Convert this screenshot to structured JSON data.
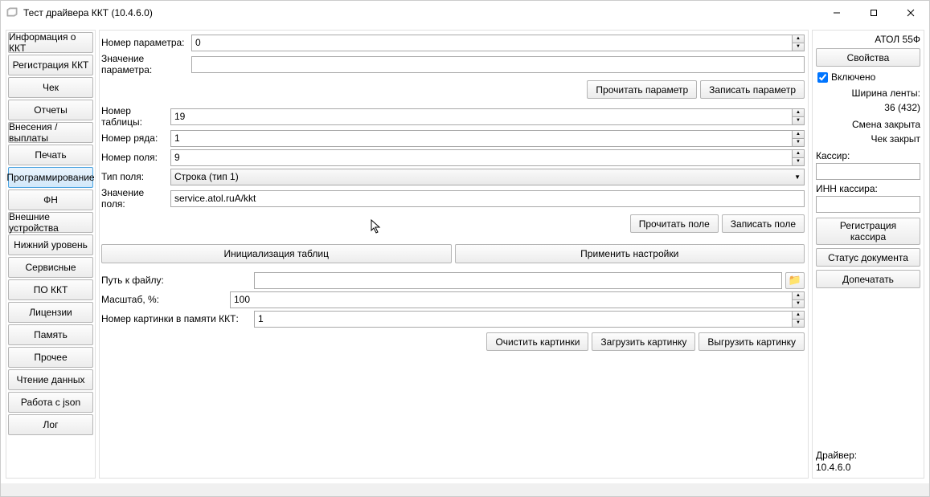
{
  "window_title": "Тест драйвера ККТ (10.4.6.0)",
  "nav": [
    "Информация о ККТ",
    "Регистрация ККТ",
    "Чек",
    "Отчеты",
    "Внесения / выплаты",
    "Печать",
    "Программирование",
    "ФН",
    "Внешние устройства",
    "Нижний уровень",
    "Сервисные",
    "ПО ККТ",
    "Лицензии",
    "Память",
    "Прочее",
    "Чтение данных",
    "Работа с json",
    "Лог"
  ],
  "nav_active_index": 6,
  "labels": {
    "param_number": "Номер параметра:",
    "param_value": "Значение параметра:",
    "read_param": "Прочитать параметр",
    "write_param": "Записать параметр",
    "table_number": "Номер таблицы:",
    "row_number": "Номер ряда:",
    "field_number": "Номер поля:",
    "field_type": "Тип поля:",
    "field_value": "Значение поля:",
    "read_field": "Прочитать поле",
    "write_field": "Записать поле",
    "init_tables": "Инициализация таблиц",
    "apply_settings": "Применить настройки",
    "file_path": "Путь к файлу:",
    "scale": "Масштаб, %:",
    "image_number": "Номер картинки в памяти ККТ:",
    "clear_images": "Очистить картинки",
    "load_image": "Загрузить картинку",
    "unload_image": "Выгрузить картинку"
  },
  "values": {
    "param_number": "0",
    "param_value": "",
    "table_number": "19",
    "row_number": "1",
    "field_number": "9",
    "field_type": "Строка (тип 1)",
    "field_value": "service.atol.ruA/kkt",
    "file_path": "",
    "scale": "100",
    "image_number": "1"
  },
  "side": {
    "device_name": "АТОЛ 55Ф",
    "properties": "Свойства",
    "enabled_label": "Включено",
    "enabled_checked": true,
    "tape_width_label": "Ширина ленты:",
    "tape_width_value": "36 (432)",
    "shift_closed": "Смена закрыта",
    "check_closed": "Чек закрыт",
    "cashier_label": "Кассир:",
    "cashier_value": "",
    "cashier_inn_label": "ИНН кассира:",
    "cashier_inn_value": "",
    "register_cashier_l1": "Регистрация",
    "register_cashier_l2": "кассира",
    "doc_status": "Статус документа",
    "reprint": "Допечатать",
    "driver_label": "Драйвер:",
    "driver_version": "10.4.6.0"
  }
}
